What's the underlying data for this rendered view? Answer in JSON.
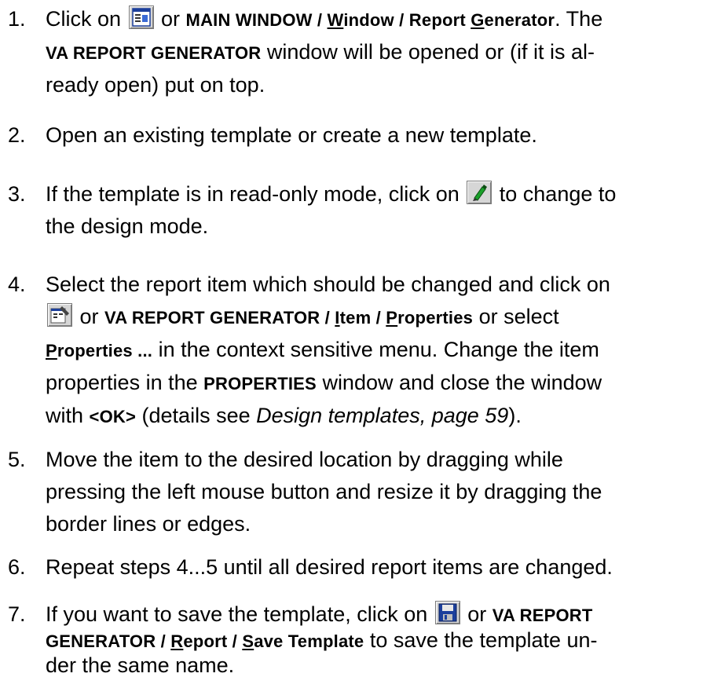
{
  "steps": [
    {
      "number": "1.",
      "t1": "Click on ",
      "icon1": "report-generator-icon",
      "t2": " or ",
      "path_a": "MAIN WINDOW / ",
      "path_w": "W",
      "path_b": "indow / Report ",
      "path_g": "G",
      "path_c": "enerator",
      "t3": ". The ",
      "win": "VA REPORT GENERATOR",
      "t4": " window will be opened or (if it is al-",
      "line2": "ready open) put on top."
    },
    {
      "number": "2.",
      "line1": "Open an existing template or create a new template."
    },
    {
      "number": "3.",
      "t1": "If the template is in read-only mode, click on ",
      "icon1": "design-mode-pen-icon",
      "t2": " to change to",
      "line2": "the design mode."
    },
    {
      "number": "4.",
      "line1": "Select the report item which should be changed and click on",
      "icon1": "properties-icon",
      "t2": " or ",
      "path_a": "VA REPORT GENERATOR / ",
      "path_i": "I",
      "path_b": "tem / ",
      "path_p": "P",
      "path_c": "roperties",
      "t3": " or select",
      "menu_p": "P",
      "menu_rest": "roperties ...",
      "t4": " in the context sensitive menu. Change the item",
      "t5": "properties in the ",
      "win": "PROPERTIES",
      "t6": " window and close the window",
      "t7": "with ",
      "ok": "<OK>",
      "t8": " (details see ",
      "ref": "Design templates, page 59",
      "t9": ")."
    },
    {
      "number": "5.",
      "line1": "Move the item to the desired location by dragging while",
      "line2": "pressing the left mouse button and resize it by dragging the",
      "line3": "border lines or edges."
    },
    {
      "number": "6.",
      "line1": "Repeat steps 4...5 until all desired report items are changed."
    },
    {
      "number": "7.",
      "t1": "If you want to save the template, click on ",
      "icon1": "save-floppy-icon",
      "t2": " or ",
      "path_a": "VA REPORT",
      "path_b": "GENERATOR / ",
      "path_r": "R",
      "path_c": "eport / ",
      "path_s": "S",
      "path_d": "ave Template",
      "t3": " to save the template un-",
      "line3": "der the same name."
    }
  ]
}
